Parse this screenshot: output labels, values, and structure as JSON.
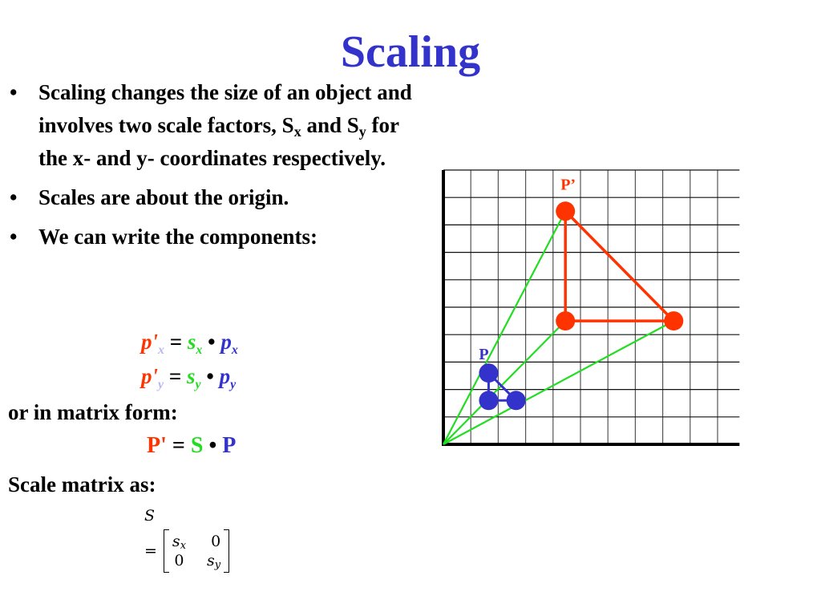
{
  "title": "Scaling",
  "bullets": [
    {
      "parts": [
        "Scaling changes the size of an object and involves two scale factors, S",
        "x",
        " and S",
        "y",
        " for the x- and y- coordinates respectively."
      ]
    },
    {
      "text": "Scales are about the origin."
    },
    {
      "text": "We can write the components:"
    }
  ],
  "bullet_symbol": "•",
  "component_equations": [
    {
      "lhs": "p'",
      "lhs_sub": "x",
      "eq": "=",
      "factor": "s",
      "factor_sub": "x",
      "dot": "•",
      "rhs": "p",
      "rhs_sub": "x"
    },
    {
      "lhs": "p'",
      "lhs_sub": "y",
      "eq": "=",
      "factor": "s",
      "factor_sub": "y",
      "dot": "•",
      "rhs": "p",
      "rhs_sub": "y"
    }
  ],
  "matrix_form_label": "or in matrix form:",
  "matrix_equation": {
    "lhs": "P'",
    "eq": "=",
    "factor": "S",
    "dot": "•",
    "rhs": "P"
  },
  "scale_matrix_label": "Scale matrix as:",
  "scale_matrix": {
    "symbol": "S",
    "eq": "=",
    "rows": [
      [
        "s",
        "x",
        "0"
      ],
      [
        "0",
        "",
        "s",
        "y"
      ]
    ],
    "cells": [
      {
        "text": "s",
        "sub": "x"
      },
      {
        "text": "0",
        "sub": ""
      },
      {
        "text": "0",
        "sub": ""
      },
      {
        "text": "s",
        "sub": "y"
      }
    ]
  },
  "colors": {
    "title": "#3333cc",
    "scaled": "#ff3300",
    "factor": "#22dd22",
    "original": "#3333cc",
    "subscript_faded": "#b8b8ee"
  },
  "chart_data": {
    "type": "scatter",
    "title": "",
    "xlabel": "",
    "ylabel": "",
    "xlim": [
      0,
      10.8
    ],
    "ylim": [
      0,
      10
    ],
    "grid": true,
    "labels": {
      "original": "P",
      "scaled": "P’"
    },
    "series": [
      {
        "name": "P",
        "color": "#3333cc",
        "points": [
          [
            1.65,
            2.6
          ],
          [
            1.65,
            1.6
          ],
          [
            2.65,
            1.6
          ]
        ],
        "closed": true
      },
      {
        "name": "P’",
        "color": "#ff3300",
        "points": [
          [
            4.45,
            8.5
          ],
          [
            4.45,
            4.5
          ],
          [
            8.4,
            4.5
          ]
        ],
        "closed": true
      }
    ],
    "rays": {
      "color": "#22dd22",
      "from": [
        0,
        0
      ],
      "to_series": "P’"
    }
  }
}
